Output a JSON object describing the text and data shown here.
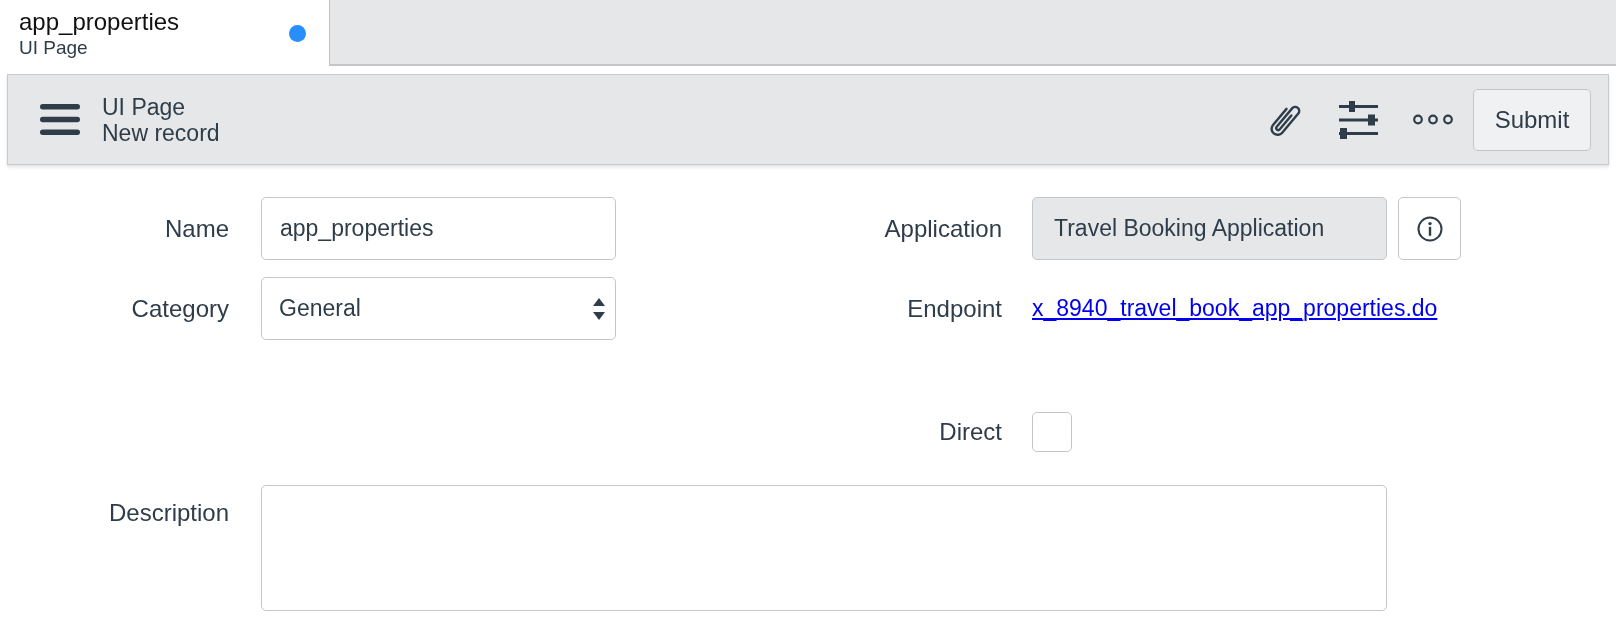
{
  "tabs": [
    {
      "title": "app_properties",
      "subtitle": "UI Page",
      "selected": true,
      "modified": true
    }
  ],
  "header": {
    "title": "UI Page",
    "subtitle": "New record",
    "actions": [
      {
        "label": "Submit"
      }
    ]
  },
  "form": {
    "columns": [
      {
        "fields": [
          {
            "label": "Name",
            "kind": "text",
            "value": "app_properties",
            "readonly": false
          },
          {
            "label": "Category",
            "kind": "select",
            "value": "General",
            "readonly": false
          }
        ]
      },
      {
        "fields": [
          {
            "label": "Application",
            "kind": "reference",
            "value": "Travel Booking Application",
            "readonly": true
          },
          {
            "label": "Endpoint",
            "kind": "link",
            "value": "x_8940_travel_book_app_properties.do",
            "readonly": false
          },
          {
            "label": "Direct",
            "kind": "checkbox",
            "checked": false,
            "readonly": false
          }
        ]
      }
    ],
    "wide_fields": [
      {
        "label": "Description",
        "kind": "textarea",
        "readonly": false
      }
    ]
  }
}
